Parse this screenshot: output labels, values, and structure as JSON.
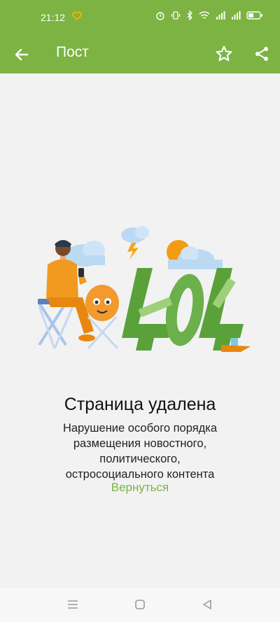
{
  "status_bar": {
    "time": "21:12",
    "icons": [
      "heart-icon",
      "alarm-icon",
      "vibrate-icon",
      "bluetooth-icon",
      "wifi-icon",
      "signal-icon",
      "signal-icon",
      "battery-icon"
    ]
  },
  "app_bar": {
    "title": "Пост",
    "back_icon": "arrow-left-icon",
    "favorite_icon": "star-outline-icon",
    "share_icon": "share-icon",
    "color": "#7cb342"
  },
  "error": {
    "illustration_text": "404",
    "title": "Страница удалена",
    "message": "Нарушение особого порядка размещения новостного, политического, остросоциального контента",
    "link_label": "Вернуться",
    "link_color": "#7cb342"
  },
  "nav_bar": {
    "icons": [
      "menu-icon",
      "home-square-icon",
      "back-triangle-icon"
    ]
  }
}
